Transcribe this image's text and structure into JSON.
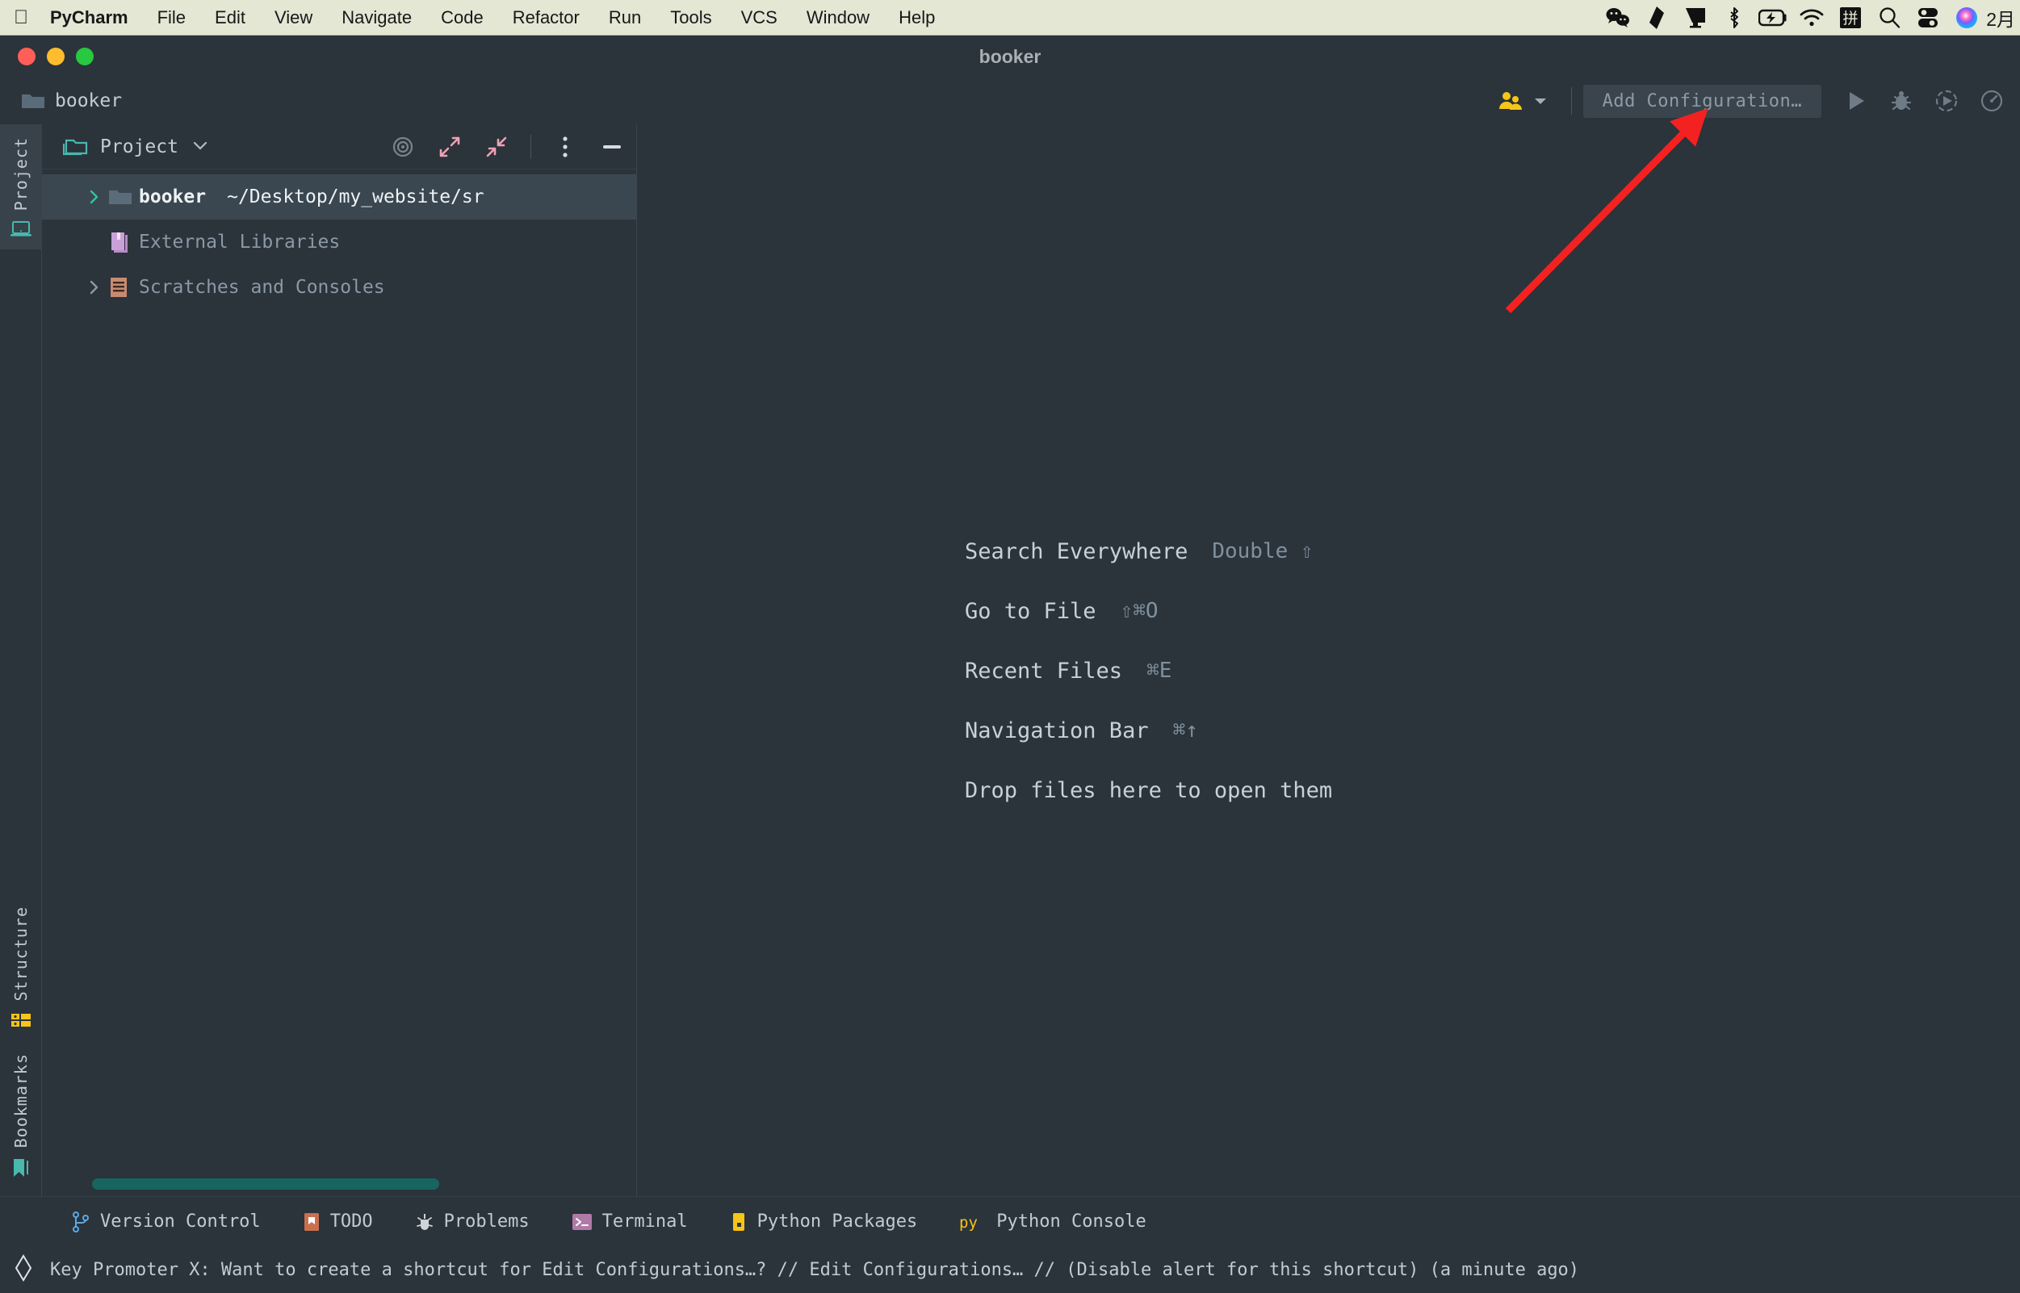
{
  "menubar": {
    "app_name": "PyCharm",
    "items": [
      "File",
      "Edit",
      "View",
      "Navigate",
      "Code",
      "Refactor",
      "Run",
      "Tools",
      "VCS",
      "Window",
      "Help"
    ],
    "tray_icons": [
      "wechat-icon",
      "kingsoft-icon",
      "display-icon",
      "bluetooth-icon",
      "battery-charging-icon",
      "wifi-icon",
      "input-method-pinyin-icon",
      "spotlight-search-icon",
      "control-center-icon",
      "siri-icon"
    ],
    "input_method_label": "拼",
    "clock": "2月"
  },
  "window": {
    "title": "booker"
  },
  "navbar": {
    "breadcrumb": "booker",
    "people_label": "",
    "add_configuration": "Add Configuration…",
    "run_icons": [
      "run-icon",
      "debug-icon",
      "run-with-coverage-icon",
      "profile-icon"
    ]
  },
  "stripe": {
    "top_tabs": [
      {
        "label": "Project",
        "icon": "project-laptop-icon",
        "active": true
      }
    ],
    "bottom_tabs": [
      {
        "label": "Structure",
        "icon": "structure-list-icon",
        "active": false
      },
      {
        "label": "Bookmarks",
        "icon": "bookmark-icon",
        "active": false
      }
    ]
  },
  "panel": {
    "title": "Project",
    "tools": [
      "select-opened-file-icon",
      "expand-all-icon",
      "collapse-all-icon",
      "more-options-icon",
      "hide-panel-icon"
    ],
    "tree": [
      {
        "name": "booker",
        "path": "~/Desktop/my_website/sr",
        "icon": "folder-icon",
        "chevron": "collapsed",
        "selected": true,
        "bold": true
      },
      {
        "name": "External Libraries",
        "path": "",
        "icon": "library-icon",
        "chevron": "none",
        "selected": false,
        "bold": false
      },
      {
        "name": "Scratches and Consoles",
        "path": "",
        "icon": "scratches-icon",
        "chevron": "collapsed",
        "selected": false,
        "bold": false
      }
    ]
  },
  "editor": {
    "hints": [
      {
        "label": "Search Everywhere",
        "shortcut": "Double ⇧"
      },
      {
        "label": "Go to File",
        "shortcut": "⇧⌘O"
      },
      {
        "label": "Recent Files",
        "shortcut": "⌘E"
      },
      {
        "label": "Navigation Bar",
        "shortcut": "⌘↑"
      },
      {
        "label": "Drop files here to open them",
        "shortcut": ""
      }
    ]
  },
  "bottom_tools": [
    {
      "label": "Version Control",
      "icon": "branch-icon"
    },
    {
      "label": "TODO",
      "icon": "todo-icon"
    },
    {
      "label": "Problems",
      "icon": "problems-icon"
    },
    {
      "label": "Terminal",
      "icon": "terminal-icon"
    },
    {
      "label": "Python Packages",
      "icon": "python-packages-icon"
    },
    {
      "label": "Python Console",
      "icon": "python-console-icon"
    }
  ],
  "statusbar": {
    "icon": "key-promoter-icon",
    "message": "Key Promoter X: Want to create a shortcut for Edit Configurations…? // Edit Configurations… // (Disable alert for this shortcut) (a minute ago)"
  },
  "annotation": {
    "arrow_color": "#f42121"
  }
}
